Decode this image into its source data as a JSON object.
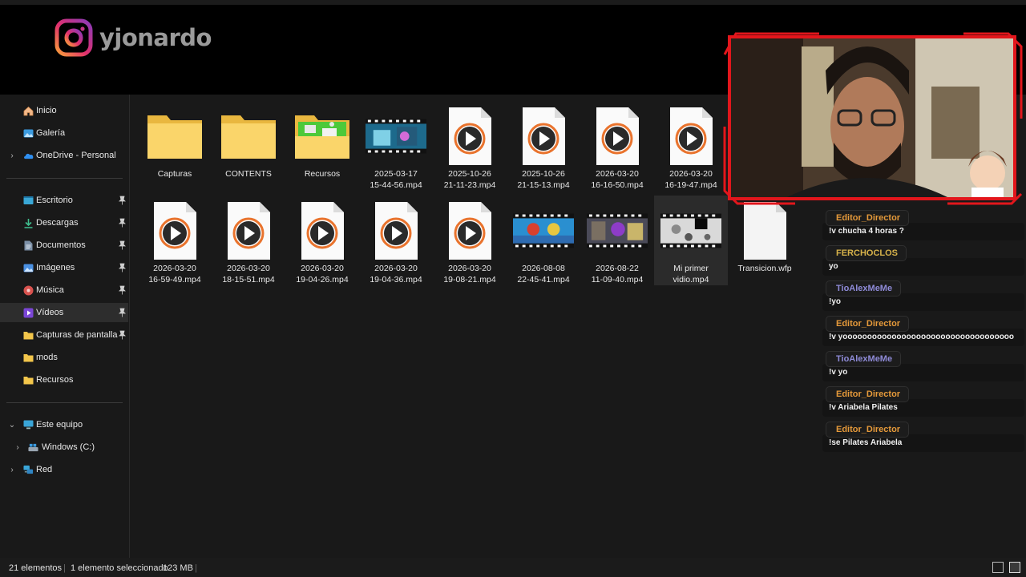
{
  "overlay": {
    "brand_name": "yjonardo",
    "brand_icon": "instagram-icon",
    "webcam_frame_color": "#e2161c"
  },
  "sidebar": {
    "quick": [
      {
        "label": "Inicio",
        "icon": "home-icon"
      },
      {
        "label": "Galería",
        "icon": "gallery-icon"
      },
      {
        "label": "OneDrive - Personal",
        "icon": "onedrive-icon"
      }
    ],
    "pinned": [
      {
        "label": "Escritorio",
        "icon": "desktop-icon"
      },
      {
        "label": "Descargas",
        "icon": "download-icon"
      },
      {
        "label": "Documentos",
        "icon": "document-icon"
      },
      {
        "label": "Imágenes",
        "icon": "pictures-icon"
      },
      {
        "label": "Música",
        "icon": "music-icon"
      },
      {
        "label": "Vídeos",
        "icon": "video-icon"
      },
      {
        "label": "Capturas de pantalla",
        "icon": "folder-icon"
      },
      {
        "label": "mods",
        "icon": "folder-icon"
      },
      {
        "label": "Recursos",
        "icon": "folder-icon"
      }
    ],
    "devices": [
      {
        "label": "Este equipo",
        "icon": "computer-icon"
      },
      {
        "label": "Windows (C:)",
        "icon": "drive-icon"
      },
      {
        "label": "Red",
        "icon": "network-icon"
      }
    ]
  },
  "files": [
    {
      "line1": "Capturas",
      "line2": "",
      "kind": "folder"
    },
    {
      "line1": "CONTENTS",
      "line2": "",
      "kind": "folder"
    },
    {
      "line1": "Recursos",
      "line2": "",
      "kind": "folder-preview"
    },
    {
      "line1": "2025-03-17",
      "line2": "15-44-56.mp4",
      "kind": "video-thumb"
    },
    {
      "line1": "2025-10-26",
      "line2": "21-11-23.mp4",
      "kind": "mp4"
    },
    {
      "line1": "2025-10-26",
      "line2": "21-15-13.mp4",
      "kind": "mp4"
    },
    {
      "line1": "2026-03-20",
      "line2": "16-16-50.mp4",
      "kind": "mp4"
    },
    {
      "line1": "2026-03-20",
      "line2": "16-19-47.mp4",
      "kind": "mp4"
    },
    {
      "line1": "2026-03-20",
      "line2": "16-59-49.mp4",
      "kind": "mp4"
    },
    {
      "line1": "2026-03-20",
      "line2": "18-15-51.mp4",
      "kind": "mp4"
    },
    {
      "line1": "2026-03-20",
      "line2": "19-04-26.mp4",
      "kind": "mp4"
    },
    {
      "line1": "2026-03-20",
      "line2": "19-04-36.mp4",
      "kind": "mp4"
    },
    {
      "line1": "2026-03-20",
      "line2": "19-08-21.mp4",
      "kind": "mp4"
    },
    {
      "line1": "2026-08-08",
      "line2": "22-45-41.mp4",
      "kind": "video-thumb"
    },
    {
      "line1": "2026-08-22",
      "line2": "11-09-40.mp4",
      "kind": "video-thumb"
    },
    {
      "line1": "Mi primer",
      "line2": "vidio.mp4",
      "kind": "video-thumb"
    },
    {
      "line1": "Transicion.wfp",
      "line2": "",
      "kind": "blank-doc"
    }
  ],
  "status": {
    "count": "21 elementos",
    "selection": "1 elemento seleccionado",
    "size": "123 MB"
  },
  "chat": [
    {
      "user": "Editor_Director",
      "text": "!v chucha 4 horas ?",
      "color": "#e69a3a"
    },
    {
      "user": "FERCHOCLOS",
      "text": "yo",
      "color": "#d7b24a"
    },
    {
      "user": "TioAlexMeMe",
      "text": "!yo",
      "color": "#8f8bd8"
    },
    {
      "user": "Editor_Director",
      "text": "!v yooooooooooooooooooooooooooooooooooo",
      "color": "#e69a3a"
    },
    {
      "user": "TioAlexMeMe",
      "text": "!v yo",
      "color": "#8f8bd8"
    },
    {
      "user": "Editor_Director",
      "text": "!v Ariabela Pilates",
      "color": "#e69a3a"
    },
    {
      "user": "Editor_Director",
      "text": "!se Pilates Ariabela",
      "color": "#e69a3a"
    }
  ]
}
